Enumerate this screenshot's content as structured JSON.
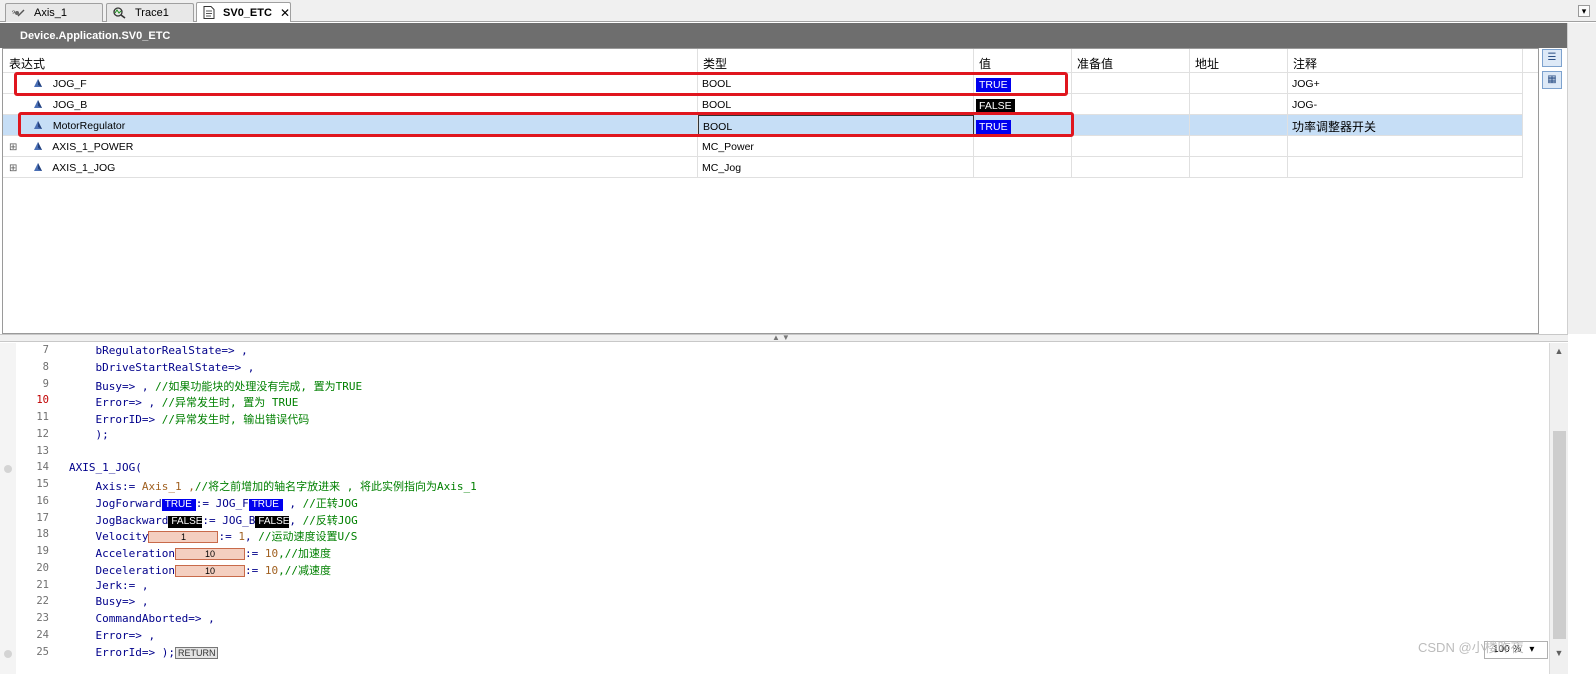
{
  "tabs": [
    {
      "label": "Axis_1",
      "icon": "axis-icon"
    },
    {
      "label": "Trace1",
      "icon": "trace-icon"
    },
    {
      "label": "SV0_ETC",
      "icon": "document-icon",
      "active": true
    }
  ],
  "watch": {
    "path": "Device.Application.SV0_ETC",
    "headers": {
      "expression": "表达式",
      "type": "类型",
      "value": "值",
      "prepared": "准备值",
      "address": "地址",
      "comment": "注释"
    },
    "rows": [
      {
        "expression": "JOG_F",
        "type": "BOOL",
        "value": "TRUE",
        "comment": "JOG+",
        "expandable": false
      },
      {
        "expression": "JOG_B",
        "type": "BOOL",
        "value": "FALSE",
        "comment": "JOG-",
        "expandable": false
      },
      {
        "expression": "MotorRegulator",
        "type": "BOOL",
        "value": "TRUE",
        "comment": "功率调整器开关",
        "expandable": false,
        "selected": true
      },
      {
        "expression": "AXIS_1_POWER",
        "type": "MC_Power",
        "value": "",
        "comment": "",
        "expandable": true
      },
      {
        "expression": "AXIS_1_JOG",
        "type": "MC_Jog",
        "value": "",
        "comment": "",
        "expandable": true
      }
    ]
  },
  "code": {
    "line_numbers": [
      "7",
      "8",
      "9",
      "10",
      "11",
      "12",
      "13",
      "14",
      "15",
      "16",
      "17",
      "18",
      "19",
      "20",
      "21",
      "22",
      "23",
      "24",
      "25"
    ],
    "l7": "    bRegulatorRealState=> ,",
    "l8": "    bDriveStartRealState=> ,",
    "l9_a": "    Busy=> , ",
    "l9_c": "//如果功能块的处理没有完成, 置为TRUE",
    "l10_a": "    Error=> , ",
    "l10_c": "//异常发生时, 置为 TRUE",
    "l11_a": "    ErrorID=> ",
    "l11_c": "//异常发生时, 输出错误代码",
    "l12": "    );",
    "l14": "AXIS_1_JOG(",
    "l15_a": "    Axis:= ",
    "l15_b": "Axis_1 ,",
    "l15_c": "//将之前增加的轴名字放进来 , 将此实例指向为Axis_1",
    "l16_a": "    JogForward",
    "l16_v1": "TRUE",
    "l16_b": ":= JOG_F",
    "l16_v2": "TRUE",
    "l16_c": " , ",
    "l16_d": "//正转JOG",
    "l17_a": "    JogBackward",
    "l17_v1": "FALSE",
    "l17_b": ":= JOG_B",
    "l17_v2": "FALSE",
    "l17_c": ", ",
    "l17_d": "//反转JOG",
    "l18_a": "    Velocity",
    "l18_v": "1",
    "l18_b": ":= ",
    "l18_n": "1",
    "l18_c": ", ",
    "l18_d": "//运动速度设置U/S",
    "l19_a": "    Acceleration",
    "l19_v": "10",
    "l19_b": ":= ",
    "l19_n": "10",
    "l19_c": ",//加速度",
    "l20_a": "    Deceleration",
    "l20_v": "10",
    "l20_b": ":= ",
    "l20_n": "10",
    "l20_c": ",//减速度",
    "l21": "    Jerk:= ,",
    "l22": "    Busy=> ,",
    "l23": "    CommandAborted=> ,",
    "l24": "    Error=> ,",
    "l25_a": "    ErrorId=> );",
    "l25_ret": "RETURN"
  },
  "zoom": "100 %",
  "watermark": "CSDN @小楼昨夜",
  "colors": {
    "true_bg": "#0000ee",
    "false_bg": "#000000",
    "highlight_box": "#e0161e",
    "selected_row": "#c6def6",
    "comment": "#008000"
  }
}
